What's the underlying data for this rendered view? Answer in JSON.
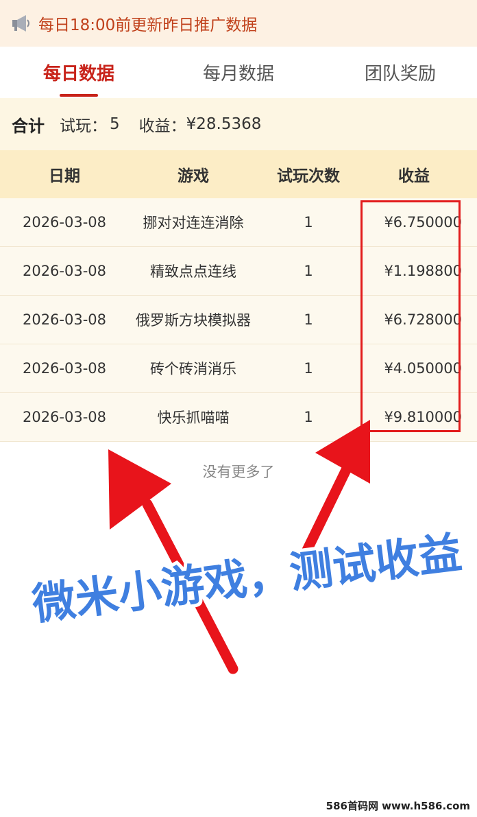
{
  "notice": {
    "icon": "megaphone-icon",
    "text": "每日18:00前更新昨日推广数据"
  },
  "tabs": [
    {
      "label": "每日数据",
      "active": true
    },
    {
      "label": "每月数据",
      "active": false
    },
    {
      "label": "团队奖励",
      "active": false
    }
  ],
  "summary": {
    "total_label": "合计",
    "trial_label": "试玩：",
    "trial_value": "5",
    "income_label": "收益：",
    "income_value": "¥28.5368"
  },
  "table": {
    "headers": [
      "日期",
      "游戏",
      "试玩次数",
      "收益"
    ],
    "rows": [
      {
        "date": "2026-03-08",
        "game": "挪对对连连消除",
        "count": "1",
        "income": "¥6.750000"
      },
      {
        "date": "2026-03-08",
        "game": "精致点点连线",
        "count": "1",
        "income": "¥1.198800"
      },
      {
        "date": "2026-03-08",
        "game": "俄罗斯方块模拟器",
        "count": "1",
        "income": "¥6.728000"
      },
      {
        "date": "2026-03-08",
        "game": "砖个砖消消乐",
        "count": "1",
        "income": "¥4.050000"
      },
      {
        "date": "2026-03-08",
        "game": "快乐抓喵喵",
        "count": "1",
        "income": "¥9.810000"
      }
    ]
  },
  "no_more": "没有更多了",
  "annotation": {
    "caption": "微米小游戏，测试收益",
    "arrow_color": "#e8141b",
    "caption_color": "#3f7fe0"
  },
  "watermark": "586首码网 www.h586.com",
  "colors": {
    "accent": "#c8231a",
    "notice_bg": "#fdf1e3",
    "header_bg": "#fcedc6",
    "row_bg": "#fdf9ee"
  }
}
